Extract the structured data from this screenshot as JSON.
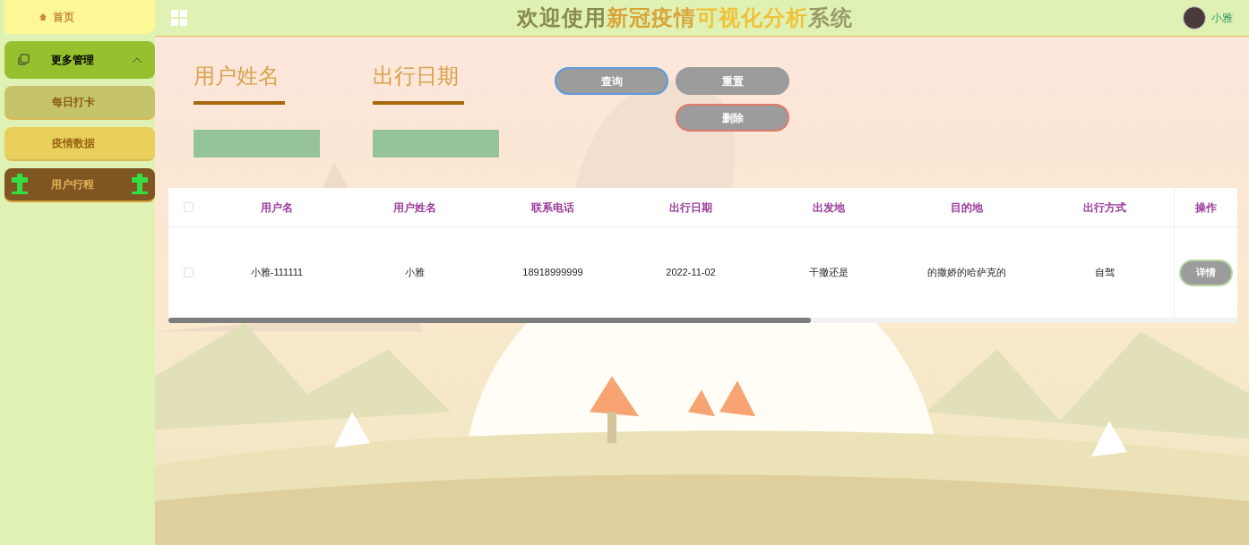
{
  "sidebar": {
    "items": [
      {
        "kind": "home",
        "label": "首页",
        "selected": false
      },
      {
        "kind": "group",
        "label": "更多管理",
        "expanded": true,
        "children": [
          {
            "label": "每日打卡",
            "selected": true
          },
          {
            "label": "疫情数据",
            "selected": false
          }
        ]
      },
      {
        "kind": "special",
        "label": "用户行程",
        "selected": false
      }
    ]
  },
  "header": {
    "title_parts": [
      {
        "text": "欢迎使用",
        "color": "#8a8a4a"
      },
      {
        "text": "新冠疫情",
        "color": "#d9a43a"
      },
      {
        "text": "可视化分析",
        "color": "#f0c23a"
      },
      {
        "text": "系统",
        "color": "#9a9a6a"
      }
    ],
    "user": "小雅"
  },
  "search": {
    "fields": [
      {
        "label": "用户姓名"
      },
      {
        "label": "出行日期"
      }
    ],
    "buttons": [
      {
        "kind": "query",
        "label": "查询"
      },
      {
        "kind": "reset",
        "label": "重置"
      },
      {
        "kind": "delete",
        "label": "删除"
      }
    ]
  },
  "table": {
    "select_all": false,
    "columns": [
      "用户名",
      "用户姓名",
      "联系电话",
      "出行日期",
      "出发地",
      "目的地",
      "出行方式",
      "操作"
    ],
    "rows": [
      {
        "checked": false,
        "cells": [
          "小雅-111111",
          "小雅",
          "18918999999",
          "2022-11-02",
          "干撤还是",
          "的撒娇的哈萨克的",
          "自驾"
        ],
        "action": "详情"
      }
    ]
  }
}
